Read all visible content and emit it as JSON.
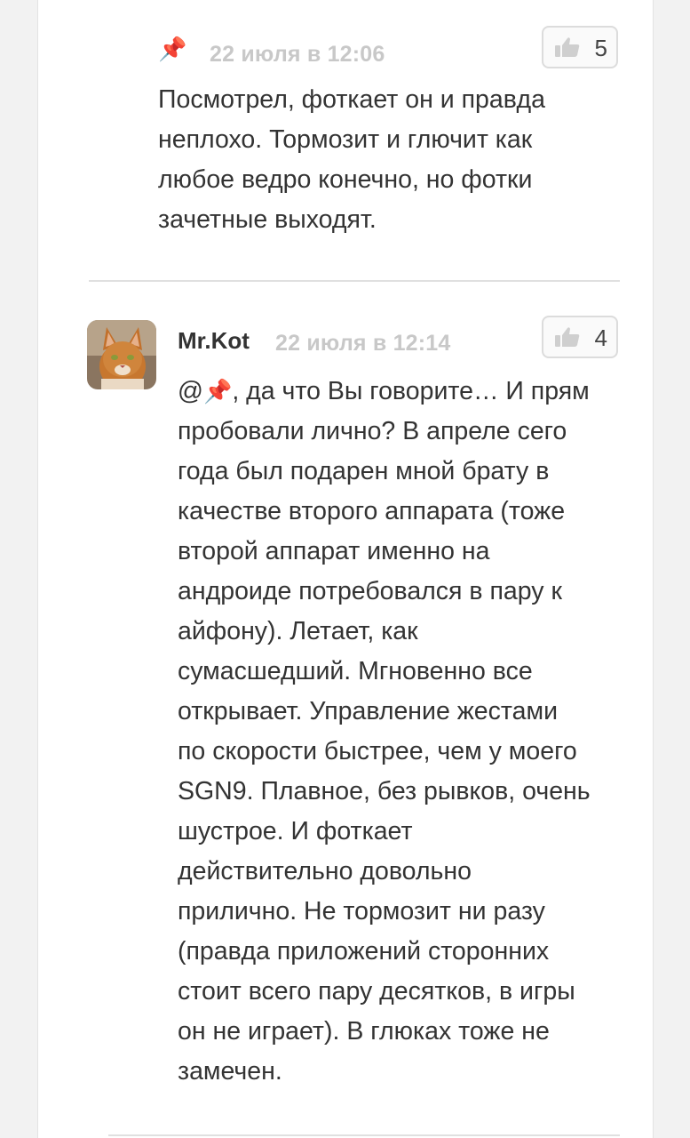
{
  "comments": [
    {
      "author": "",
      "date": "22 июля в 12:06",
      "likes": "5",
      "text": "Посмотрел, фоткает он и правда\nнеплохо. Тормозит и глючит как\nлюбое ведро конечно, но фотки\nзачетные выходят."
    },
    {
      "author": "Mr.Kot",
      "date": "22 июля в 12:14",
      "likes": "4",
      "mention_prefix": "@",
      "text_after_mention": ", да что Вы говорите… И прям\nпробовали лично? В апреле сего\nгода был подарен мной брату в\nкачестве второго аппарата (тоже\nвторой аппарат именно на\nандроиде потребовался в пару к\nайфону). Летает, как\nсумасшедший. Мгновенно все\nоткрывает. Управление жестами\nпо скорости быстрее, чем у моего\nSGN9. Плавное, без рывков, очень\nшустрое. И фоткает\nдействительно довольно\nприлично. Не тормозит ни разу\n(правда приложений сторонних\nстоит всего пару десятков, в игры\nон не играет). В глюках тоже не\nзамечен."
    }
  ],
  "icons": {
    "pin": "pushpin-icon",
    "like": "thumbs-up-icon"
  },
  "colors": {
    "date": "#c8c8c8",
    "text": "#333333",
    "like_border": "#dcdcdc",
    "pin": "#e0453d"
  }
}
